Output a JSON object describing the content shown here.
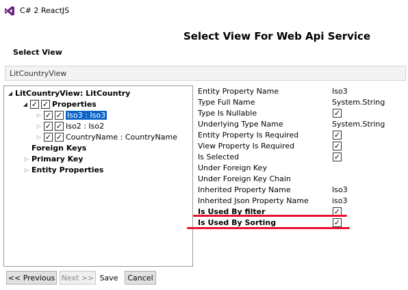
{
  "window": {
    "title": "C# 2 ReactJS"
  },
  "page": {
    "heading": "Select View For Web Api Service",
    "select_view_label": "Select View",
    "selected_view": "LitCountryView"
  },
  "tree": {
    "root_label": "LitCountryView: LitCountry",
    "properties_label": "Properties",
    "properties_checked": true,
    "items": [
      {
        "label": "Iso3 : Iso3",
        "checked": true,
        "selected": true
      },
      {
        "label": "Iso2 : Iso2",
        "checked": true,
        "selected": false
      },
      {
        "label": "CountryName : CountryName",
        "checked": true,
        "selected": false
      }
    ],
    "foreign_keys_label": "Foreign Keys",
    "primary_key_label": "Primary Key",
    "entity_properties_label": "Entity Properties"
  },
  "properties": [
    {
      "name": "Entity Property Name",
      "value": "Iso3",
      "checkbox": false,
      "bold": false
    },
    {
      "name": "Type Full Name",
      "value": "System.String",
      "checkbox": false,
      "bold": false
    },
    {
      "name": "Type Is Nullable",
      "value": "",
      "checkbox": true,
      "bold": false
    },
    {
      "name": "Underlying Type Name",
      "value": "System.String",
      "checkbox": false,
      "bold": false
    },
    {
      "name": "Entity Property Is Required",
      "value": "",
      "checkbox": true,
      "bold": false
    },
    {
      "name": "View Property Is Required",
      "value": "",
      "checkbox": true,
      "bold": false
    },
    {
      "name": "Is Selected",
      "value": "",
      "checkbox": true,
      "bold": false
    },
    {
      "name": "Under Foreign Key",
      "value": "",
      "checkbox": false,
      "bold": false
    },
    {
      "name": "Under Foreign Key Chain",
      "value": "",
      "checkbox": false,
      "bold": false
    },
    {
      "name": "Inherited Property Name",
      "value": "Iso3",
      "checkbox": false,
      "bold": false
    },
    {
      "name": "Inherited Json Property Name",
      "value": "iso3",
      "checkbox": false,
      "bold": false
    },
    {
      "name": "Is Used By filter",
      "value": "",
      "checkbox": true,
      "bold": true
    },
    {
      "name": "Is Used By Sorting",
      "value": "",
      "checkbox": true,
      "bold": true
    }
  ],
  "buttons": {
    "previous": "<< Previous",
    "next": "Next >>",
    "save": "Save",
    "cancel": "Cancel"
  },
  "colors": {
    "selection": "#0a64c8",
    "annotation_red": "#e8112d",
    "vs_purple": "#68217a"
  },
  "icons": {
    "check": "✓",
    "expanded": "◢",
    "collapsed": "▷"
  }
}
